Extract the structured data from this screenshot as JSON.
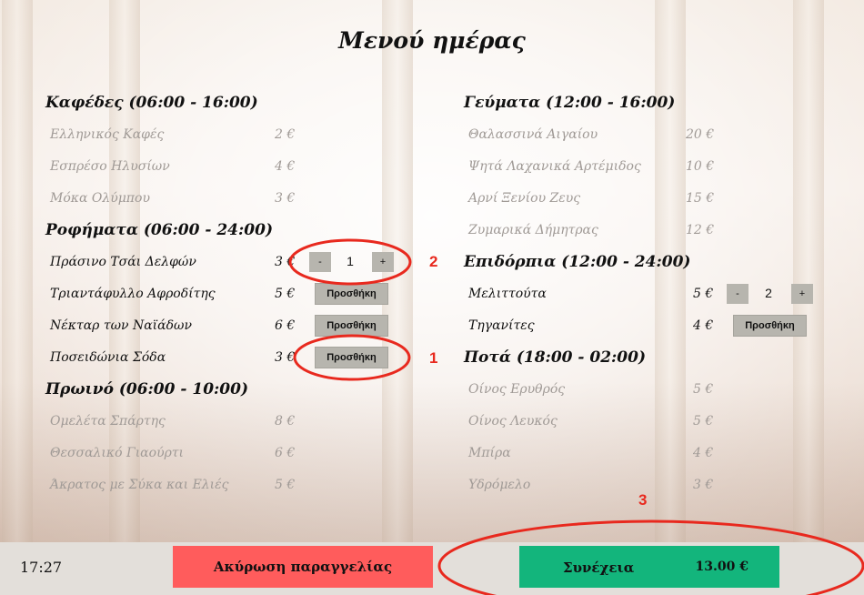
{
  "title": "Μενού ημέρας",
  "sections": {
    "coffees": {
      "title": "Καφέδες (06:00 - 16:00)",
      "items": [
        {
          "name": "Ελληνικός Καφές",
          "price": "2 €"
        },
        {
          "name": "Εσπρέσο Ηλυσίων",
          "price": "4 €"
        },
        {
          "name": "Μόκα Ολύμπου",
          "price": "3 €"
        }
      ]
    },
    "drinks": {
      "title": "Ροφήματα (06:00 - 24:00)",
      "items": [
        {
          "name": "Πράσινο Τσάι Δελφών",
          "price": "3 €",
          "qty": "1"
        },
        {
          "name": "Τριαντάφυλλο Αφροδίτης",
          "price": "5 €",
          "add": "Προσθήκη"
        },
        {
          "name": "Νέκταρ των Ναϊάδων",
          "price": "6 €",
          "add": "Προσθήκη"
        },
        {
          "name": "Ποσειδώνια Σόδα",
          "price": "3 €",
          "add": "Προσθήκη"
        }
      ]
    },
    "breakfast": {
      "title": "Πρωινό (06:00 - 10:00)",
      "items": [
        {
          "name": "Ομελέτα Σπάρτης",
          "price": "8 €"
        },
        {
          "name": "Θεσσαλικό Γιαούρτι",
          "price": "6 €"
        },
        {
          "name": "Άκρατος με Σύκα και Ελιές",
          "price": "5 €"
        }
      ]
    },
    "meals": {
      "title": "Γεύματα (12:00 - 16:00)",
      "items": [
        {
          "name": "Θαλασσινά Αιγαίου",
          "price": "20 €"
        },
        {
          "name": "Ψητά Λαχανικά Αρτέμιδος",
          "price": "10 €"
        },
        {
          "name": "Αρνί Ξενίου Ζευς",
          "price": "15 €"
        },
        {
          "name": "Ζυμαρικά Δήμητρας",
          "price": "12 €"
        }
      ]
    },
    "desserts": {
      "title": "Επιδόρπια (12:00 - 24:00)",
      "items": [
        {
          "name": "Μελιττούτα",
          "price": "5 €",
          "qty": "2"
        },
        {
          "name": "Τηγανίτες",
          "price": "4 €",
          "add": "Προσθήκη"
        }
      ]
    },
    "beverages": {
      "title": "Ποτά (18:00 - 02:00)",
      "items": [
        {
          "name": "Οίνος Ερυθρός",
          "price": "5 €"
        },
        {
          "name": "Οίνος Λευκός",
          "price": "5 €"
        },
        {
          "name": "Μπίρα",
          "price": "4 €"
        },
        {
          "name": "Υδρόμελο",
          "price": "3 €"
        }
      ]
    }
  },
  "stepper": {
    "minus": "-",
    "plus": "+"
  },
  "footer": {
    "time": "17:27",
    "cancel_label": "Ακύρωση παραγγελίας",
    "continue_label": "Συνέχεια",
    "total": "13.00 €"
  },
  "annotations": {
    "one": "1",
    "two": "2",
    "three": "3"
  },
  "colors": {
    "cancel": "#ff5c5c",
    "continue": "#13b57c",
    "annotation": "#e8291e",
    "button": "#b7b5ae"
  }
}
